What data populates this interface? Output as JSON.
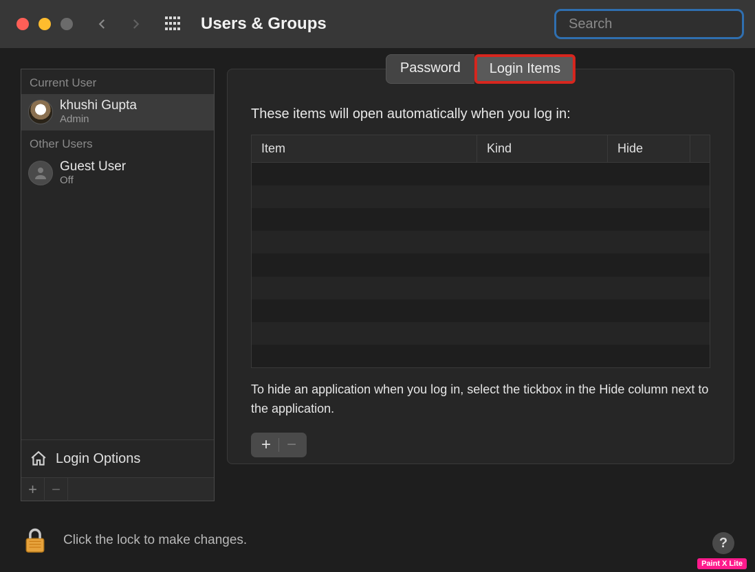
{
  "window": {
    "title": "Users & Groups",
    "search_placeholder": "Search"
  },
  "sidebar": {
    "sections": {
      "current_label": "Current User",
      "other_label": "Other Users"
    },
    "current_user": {
      "name": "khushi Gupta",
      "role": "Admin"
    },
    "other_users": [
      {
        "name": "Guest User",
        "role": "Off"
      }
    ],
    "login_options_label": "Login Options"
  },
  "tabs": {
    "password": "Password",
    "login_items": "Login Items",
    "active": "login_items"
  },
  "main": {
    "intro": "These items will open automatically when you log in:",
    "columns": {
      "item": "Item",
      "kind": "Kind",
      "hide": "Hide"
    },
    "rows": [],
    "hint": "To hide an application when you log in, select the tickbox in the Hide column next to the application."
  },
  "footer": {
    "lock_text": "Click the lock to make changes.",
    "help": "?"
  },
  "watermark": "Paint X Lite"
}
